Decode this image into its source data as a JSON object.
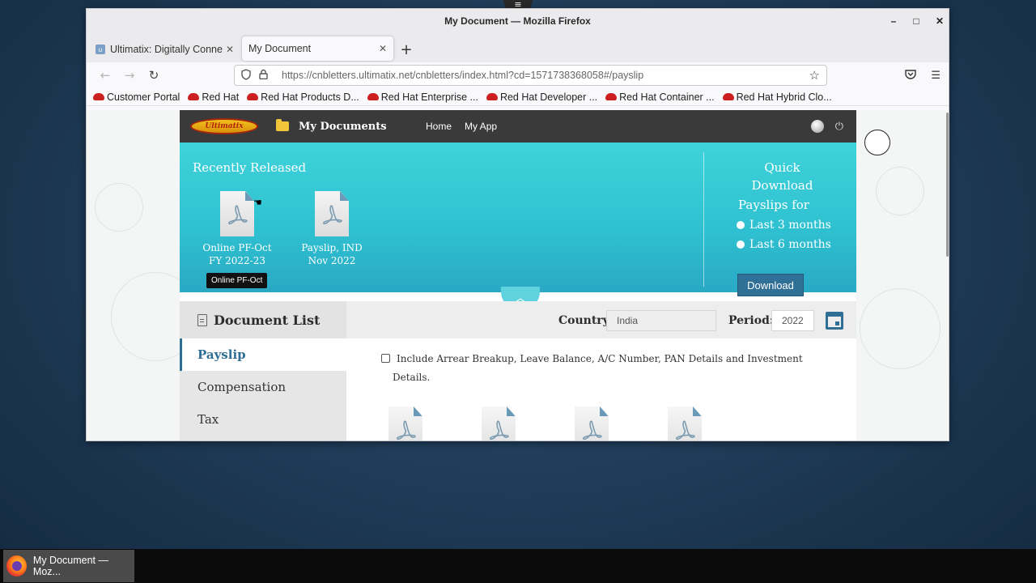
{
  "window": {
    "title": "My Document — Mozilla Firefox",
    "controls": {
      "minimize": "–",
      "maximize": "□",
      "close": "✕"
    }
  },
  "tabs": [
    {
      "label": "Ultimatix: Digitally Conne",
      "close": "✕",
      "active": false
    },
    {
      "label": "My Document",
      "close": "✕",
      "active": true
    }
  ],
  "newtab_label": "+",
  "nav": {
    "back": "←",
    "forward": "→",
    "reload": "↻",
    "url": "https://cnbletters.ultimatix.net/cnbletters/index.html?cd=1571738368058#/payslip"
  },
  "bookmarks": [
    "Customer Portal",
    "Red Hat",
    "Red Hat Products D...",
    "Red Hat Enterprise ...",
    "Red Hat Developer ...",
    "Red Hat Container ...",
    "Red Hat Hybrid Clo..."
  ],
  "app": {
    "logo_text": "Ultimatix",
    "title": "My Documents",
    "nav": [
      "Home",
      "My App"
    ]
  },
  "banner": {
    "recently_released": "Recently Released",
    "docs": [
      {
        "line1": "Online PF-Oct",
        "line2": "FY 2022-23"
      },
      {
        "line1": "Payslip, IND",
        "line2": "Nov 2022"
      }
    ],
    "tooltip": "Online PF-Oct",
    "quick_download": {
      "line1": "Quick",
      "line2": "Download",
      "sub": "Payslips for"
    },
    "options": [
      "Last 3 months",
      "Last 6 months"
    ],
    "download_button": "Download"
  },
  "doc_list": {
    "title": "Document List",
    "country_label": "Country",
    "country_value": "India",
    "period_label": "Period:",
    "period_value": "2022",
    "menu": [
      "Payslip",
      "Compensation",
      "Tax"
    ],
    "active_menu": "Payslip",
    "arrear_text_line1": "Include Arrear Breakup, Leave Balance, A/C Number, PAN Details and Investment",
    "arrear_text_line2": "Details."
  },
  "taskbar": {
    "item_label": "My Document — Moz..."
  },
  "colors": {
    "banner": "#2ec0d0",
    "accent": "#2f6e95",
    "header": "#3a3a3a"
  }
}
